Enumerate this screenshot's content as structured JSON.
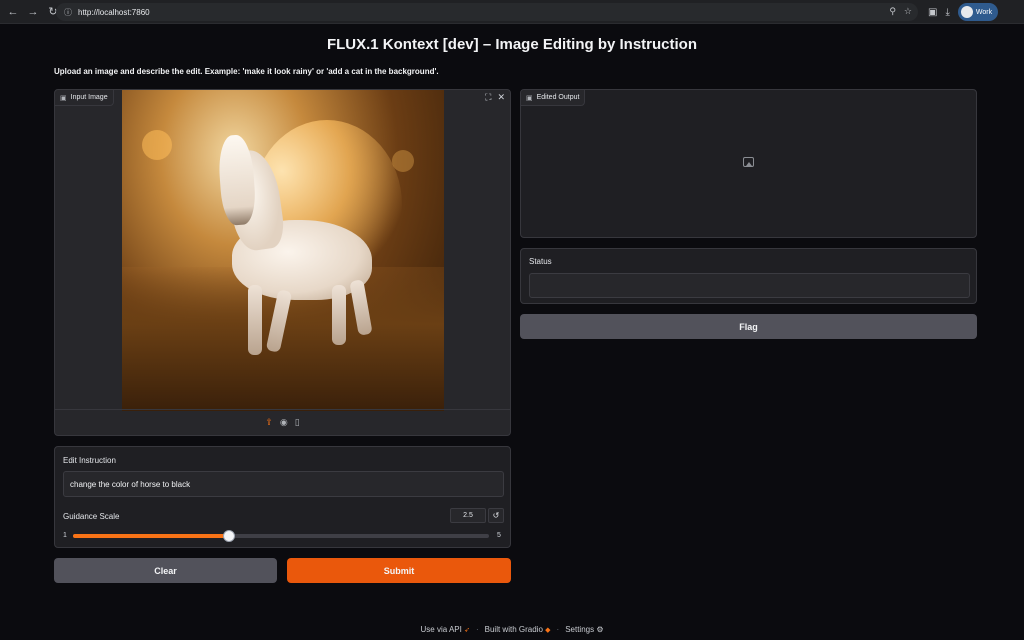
{
  "browser": {
    "url": "http://localhost:7860",
    "profile_label": "Work"
  },
  "app": {
    "title": "FLUX.1 Kontext [dev] – Image Editing by Instruction",
    "description": "Upload an image and describe the edit. Example: 'make it look rainy' or 'add a cat in the background'."
  },
  "input_image": {
    "label": "Input Image",
    "icons": [
      "upload-icon",
      "webcam-icon",
      "clipboard-icon"
    ],
    "corner_icons": [
      "fullscreen-icon",
      "close-icon"
    ]
  },
  "edited_output": {
    "label": "Edited Output",
    "placeholder_icon": "image-icon"
  },
  "status": {
    "label": "Status",
    "value": ""
  },
  "flag_button": {
    "label": "Flag"
  },
  "edit_instruction": {
    "label": "Edit Instruction",
    "value": "change the color of horse to black"
  },
  "guidance_scale": {
    "label": "Guidance Scale",
    "value": "2.5",
    "min": "1",
    "max": "5",
    "value_num": 2.5,
    "min_num": 1,
    "max_num": 5
  },
  "buttons": {
    "clear": "Clear",
    "submit": "Submit"
  },
  "footer": {
    "api": "Use via API",
    "built": "Built with Gradio",
    "settings": "Settings"
  },
  "colors": {
    "accent": "#f97316",
    "submit": "#ea580c",
    "background": "#0b0b0f",
    "panel": "#1f1f23"
  }
}
